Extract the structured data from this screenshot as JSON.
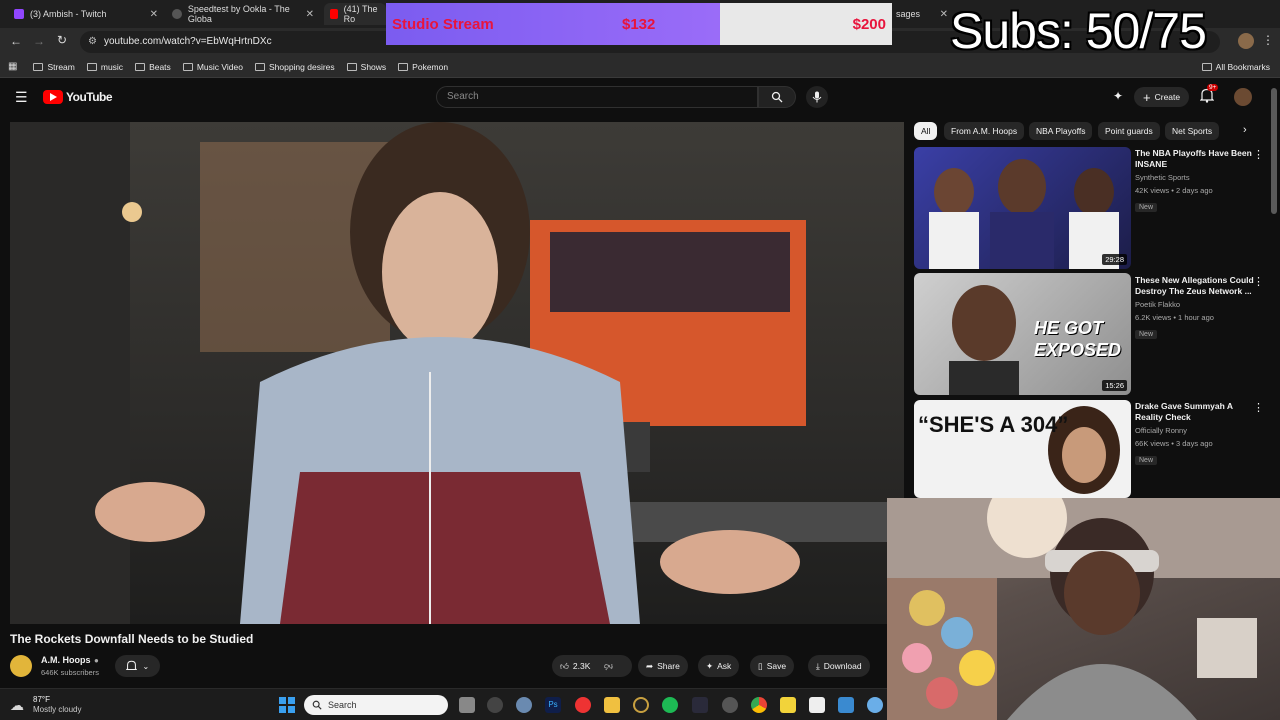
{
  "tabs": [
    {
      "label": "(3) Ambish - Twitch",
      "color": "#9146ff"
    },
    {
      "label": "Speedtest by Ookla - The Globa",
      "color": "#555555"
    },
    {
      "label": "(41) The Ro",
      "color": "#ff0000"
    },
    {
      "label": "sages",
      "color": ""
    }
  ],
  "address": {
    "url": "youtube.com/watch?v=EbWqHrtnDXc"
  },
  "bookmarks": [
    "Stream",
    "music",
    "Beats",
    "Music Video",
    "Shopping desires",
    "Shows",
    "Pokemon"
  ],
  "bookmarks_right": "All Bookmarks",
  "youtube": {
    "logo": "YouTube",
    "search_placeholder": "Search",
    "create_label": "Create",
    "notification_badge": "9+"
  },
  "video": {
    "title": "The Rockets Downfall Needs to be Studied",
    "channel": "A.M. Hoops",
    "subscribers": "646K subscribers",
    "likes": "2.3K",
    "share_label": "Share",
    "ask_label": "Ask",
    "save_label": "Save",
    "download_label": "Download"
  },
  "chips": [
    "All",
    "From A.M. Hoops",
    "NBA Playoffs",
    "Point guards",
    "Net Sports"
  ],
  "recommendations": [
    {
      "title": "The NBA Playoffs Have Been INSANE",
      "channel": "Synthetic Sports",
      "meta": "42K views • 2 days ago",
      "badge": "New",
      "duration": "29:28",
      "thumb_text": ""
    },
    {
      "title": "These New Allegations Could Destroy The Zeus Network ...",
      "channel": "Poetik Flakko",
      "meta": "6.2K views • 1 hour ago",
      "badge": "New",
      "duration": "15:26",
      "thumb_text": "HE GOT EXPOSED"
    },
    {
      "title": "Drake Gave Summyah A Reality Check",
      "channel": "Officially Ronny",
      "meta": "66K views • 3 days ago",
      "badge": "New",
      "duration": "",
      "thumb_text": "“SHE'S A 304”"
    }
  ],
  "overlay": {
    "goal_name": "Studio Stream",
    "goal_current": "$132",
    "goal_target": "$200",
    "goal_progress": 0.66,
    "subs_text": "Subs: 50/75"
  },
  "taskbar": {
    "weather_temp": "87°F",
    "weather_desc": "Mostly cloudy",
    "search_label": "Search"
  }
}
